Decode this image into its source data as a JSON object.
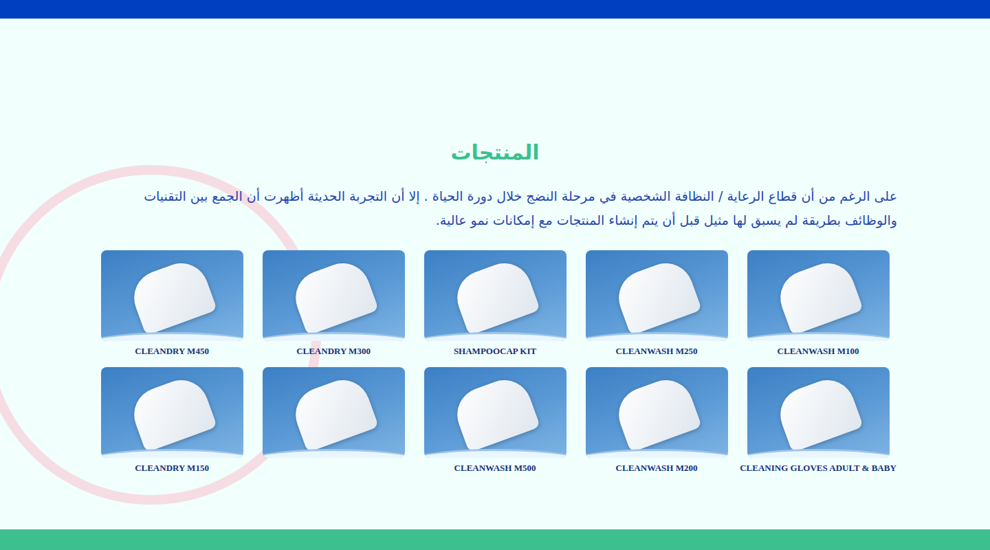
{
  "section": {
    "title": "المنتجات",
    "intro": "على الرغم من أن قطاع الرعاية / النظافة الشخصية في مرحلة النضج خلال دورة الحياة . إلا أن التجربة الحديثة أظهرت أن الجمع بين التقنيات والوظائف بطريقة لم يسبق لها مثيل قبل أن يتم إنشاء المنتجات مع إمكانات نمو عالية."
  },
  "products": [
    {
      "name": "CLEANWASH M100"
    },
    {
      "name": "CLEANWASH M250"
    },
    {
      "name": "SHAMPOOCAP KIT"
    },
    {
      "name": "CLEANDRY M300"
    },
    {
      "name": "CLEANDRY M450"
    },
    {
      "name": "CLEANING GLOVES ADULT & BABY"
    },
    {
      "name": "CLEANWASH M200"
    },
    {
      "name": "CLEANWASH M500"
    },
    {
      "name": ""
    },
    {
      "name": "CLEANDRY M150"
    }
  ]
}
